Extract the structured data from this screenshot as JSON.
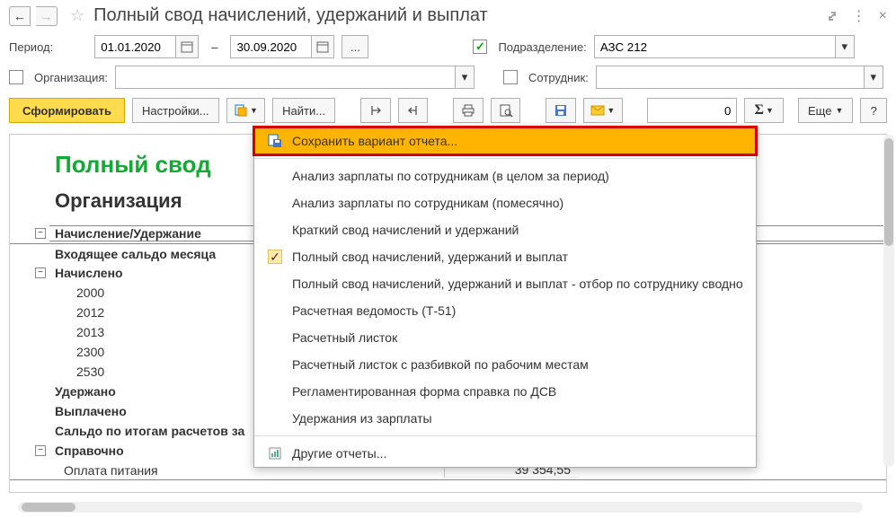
{
  "title": "Полный свод начислений, удержаний и выплат",
  "period_label": "Период:",
  "period_from": "01.01.2020",
  "period_to": "30.09.2020",
  "period_sep": "–",
  "subdivision_label": "Подразделение:",
  "subdivision_value": "АЗС 212",
  "organization_label": "Организация:",
  "organization_value": "",
  "employee_label": "Сотрудник:",
  "employee_value": "",
  "form_button": "Сформировать",
  "settings_button": "Настройки...",
  "find_button": "Найти...",
  "more_button": "Еще",
  "help_button": "?",
  "number_value": "0",
  "report": {
    "title": "Полный свод",
    "org_label": "Организация",
    "header": "Начисление/Удержание",
    "rows": [
      {
        "label": "Входящее сальдо месяца",
        "bold": true,
        "indent": 0
      },
      {
        "label": "Начислено",
        "bold": true,
        "indent": 0
      },
      {
        "label": "2000",
        "indent": 2
      },
      {
        "label": "2012",
        "indent": 2
      },
      {
        "label": "2013",
        "indent": 2
      },
      {
        "label": "2300",
        "indent": 2
      },
      {
        "label": "2530",
        "indent": 2
      },
      {
        "label": "Удержано",
        "bold": true,
        "indent": 0
      },
      {
        "label": "Выплачено",
        "bold": true,
        "indent": 0
      },
      {
        "label": "Сальдо по итогам расчетов за",
        "bold": true,
        "indent": 0
      },
      {
        "label": "Справочно",
        "bold": true,
        "indent": 0
      },
      {
        "label": "Оплата питания",
        "indent": 1
      }
    ],
    "footer_value": "39 354,55"
  },
  "dropdown": {
    "save": "Сохранить вариант отчета...",
    "items": [
      "Анализ зарплаты по сотрудникам (в целом за период)",
      "Анализ зарплаты по сотрудникам (помесячно)",
      "Краткий свод начислений и удержаний",
      "Полный свод начислений, удержаний и выплат",
      "Полный свод начислений, удержаний и выплат - отбор по сотруднику сводно",
      "Расчетная ведомость (Т-51)",
      "Расчетный листок",
      "Расчетный листок с разбивкой по рабочим местам",
      "Регламентированная форма справка по ДСВ",
      "Удержания из зарплаты"
    ],
    "selected_index": 3,
    "other": "Другие отчеты..."
  }
}
